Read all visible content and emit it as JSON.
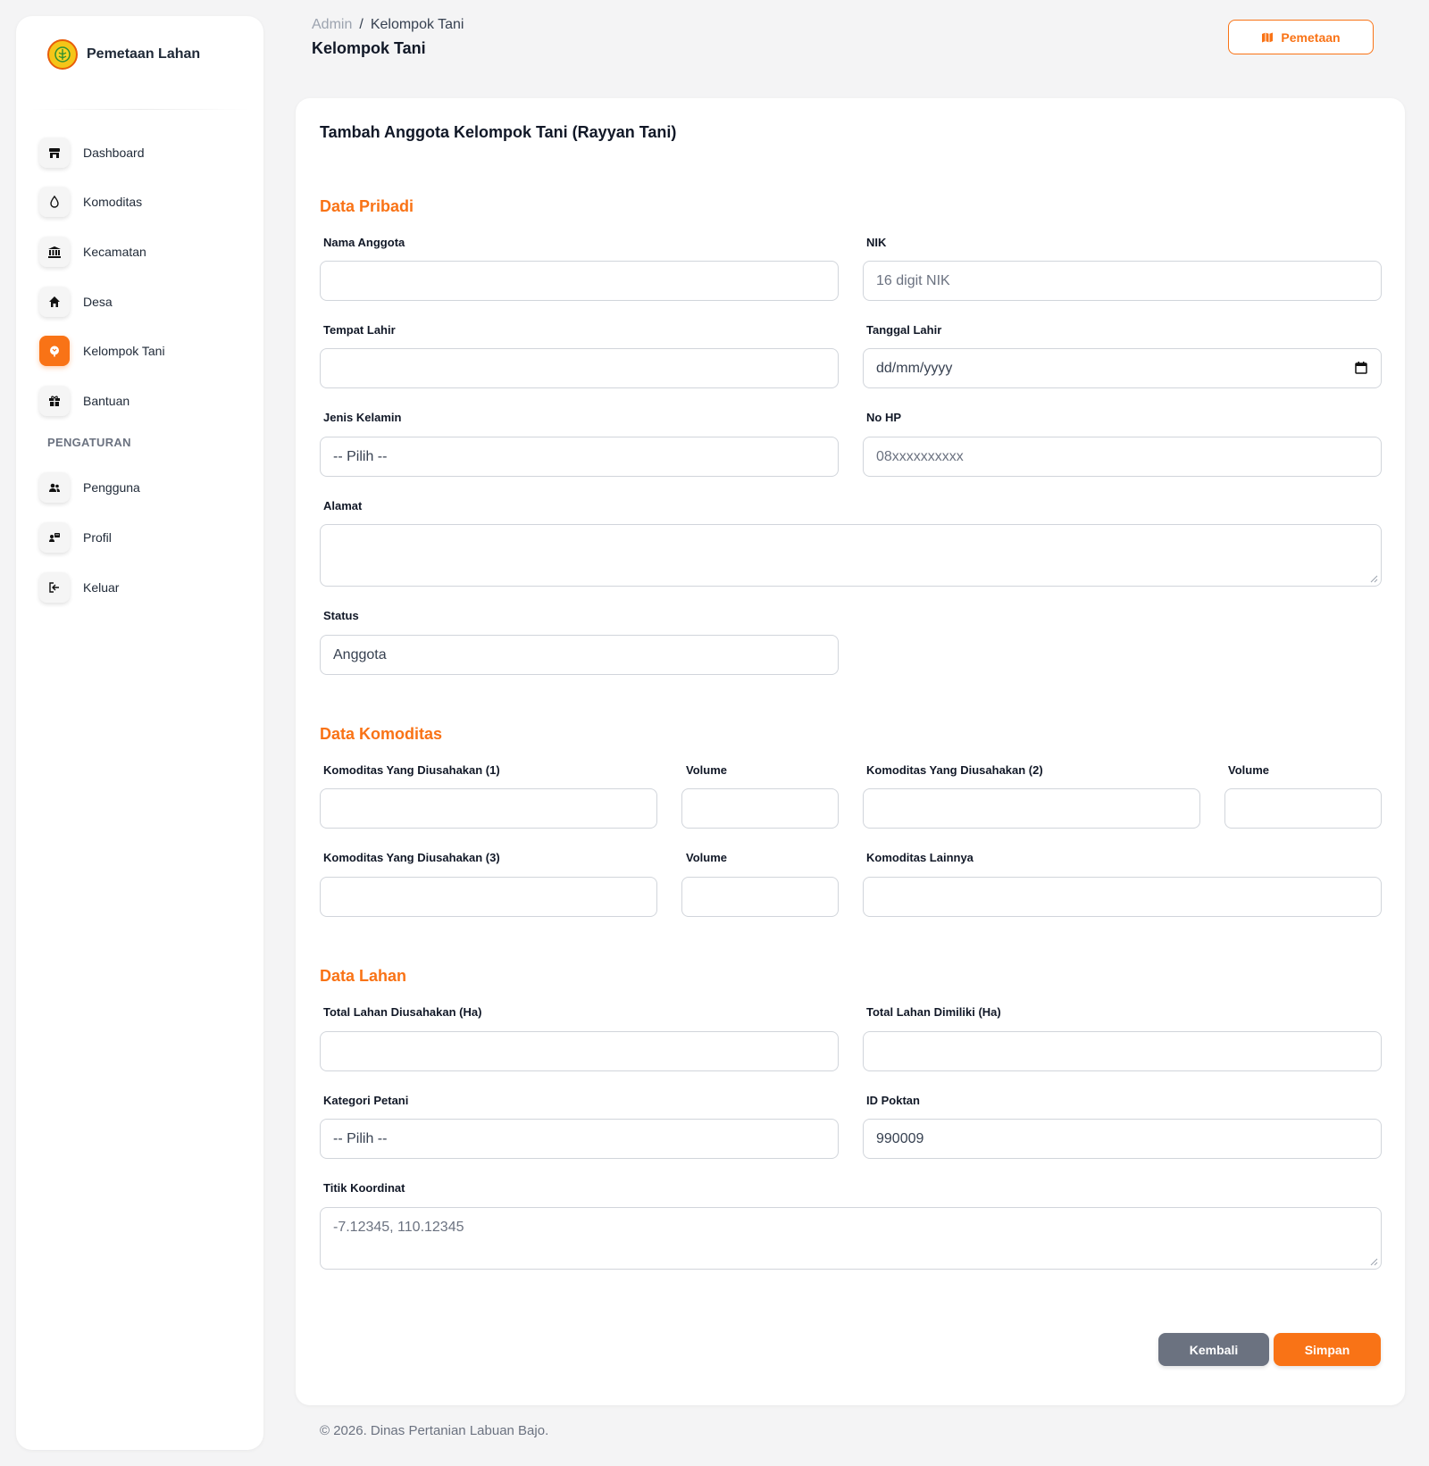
{
  "sidebar": {
    "brand": "Pemetaan Lahan",
    "items": [
      {
        "label": "Dashboard"
      },
      {
        "label": "Komoditas"
      },
      {
        "label": "Kecamatan"
      },
      {
        "label": "Desa"
      },
      {
        "label": "Kelompok Tani"
      },
      {
        "label": "Bantuan"
      }
    ],
    "section_label": "PENGATURAN",
    "settings_items": [
      {
        "label": "Pengguna"
      },
      {
        "label": "Profil"
      },
      {
        "label": "Keluar"
      }
    ],
    "active_item": "Kelompok Tani"
  },
  "header": {
    "breadcrumb_root": "Admin",
    "breadcrumb_sep": "/",
    "breadcrumb_current": "Kelompok Tani",
    "title": "Kelompok Tani",
    "map_button": "Pemetaan"
  },
  "form": {
    "title": "Tambah Anggota Kelompok Tani (Rayyan Tani)",
    "sections": {
      "pribadi": "Data Pribadi",
      "komoditas": "Data Komoditas",
      "lahan": "Data Lahan"
    },
    "fields": {
      "nama": {
        "label": "Nama Anggota",
        "value": ""
      },
      "nik": {
        "label": "NIK",
        "placeholder": "16 digit NIK"
      },
      "tempat_lahir": {
        "label": "Tempat Lahir",
        "value": ""
      },
      "tanggal_lahir": {
        "label": "Tanggal Lahir",
        "placeholder": "dd/mm/yyyy"
      },
      "jenis_kelamin": {
        "label": "Jenis Kelamin",
        "value": "-- Pilih --"
      },
      "no_hp": {
        "label": "No HP",
        "placeholder": "08xxxxxxxxxx"
      },
      "alamat": {
        "label": "Alamat",
        "value": ""
      },
      "status": {
        "label": "Status",
        "value": "Anggota"
      },
      "komoditas1": {
        "label": "Komoditas Yang Diusahakan (1)",
        "value": ""
      },
      "volume1": {
        "label": "Volume",
        "value": ""
      },
      "komoditas2": {
        "label": "Komoditas Yang Diusahakan (2)",
        "value": ""
      },
      "volume2": {
        "label": "Volume",
        "value": ""
      },
      "komoditas3": {
        "label": "Komoditas Yang Diusahakan (3)",
        "value": ""
      },
      "volume3": {
        "label": "Volume",
        "value": ""
      },
      "komoditas_lain": {
        "label": "Komoditas Lainnya",
        "value": ""
      },
      "lahan_diusahakan": {
        "label": "Total Lahan Diusahakan (Ha)",
        "value": ""
      },
      "lahan_dimiliki": {
        "label": "Total Lahan Dimiliki (Ha)",
        "value": ""
      },
      "kategori": {
        "label": "Kategori Petani",
        "value": "-- Pilih --"
      },
      "id_poktan": {
        "label": "ID Poktan",
        "value": "990009"
      },
      "koordinat": {
        "label": "Titik Koordinat",
        "placeholder": "-7.12345, 110.12345"
      }
    },
    "buttons": {
      "back": "Kembali",
      "save": "Simpan"
    }
  },
  "footer": "© 2026. Dinas Pertanian Labuan Bajo.",
  "colors": {
    "accent": "#f97316",
    "secondary_button": "#6b7280",
    "background": "#f4f4f5"
  }
}
